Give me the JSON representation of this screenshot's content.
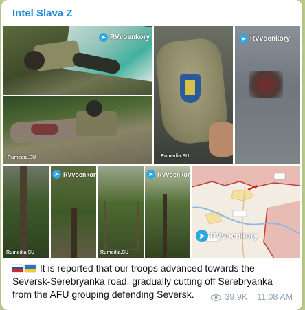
{
  "channel": {
    "name": "Intel Slava Z"
  },
  "watermarks": {
    "rvvoenkory": "RVvoenkory",
    "rumedia": "Rumedia.SU"
  },
  "flags": {
    "first": "russia-flag",
    "second": "ukraine-flag"
  },
  "message": {
    "text": "It is reported that our troops advanced towards the Seversk-Serebryanka road, gradually cutting off Serebryanka from the AFU grouping defending Seversk.",
    "views": "39.9K",
    "time": "11:08 AM"
  },
  "colors": {
    "channel_name": "#1e8ad6",
    "meta": "#8fa2b4",
    "background": "#b9c98a"
  }
}
